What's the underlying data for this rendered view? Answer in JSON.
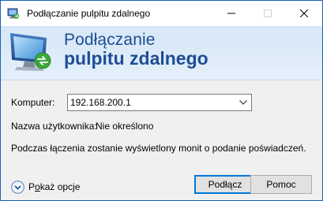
{
  "window": {
    "title": "Podłączanie pulpitu zdalnego"
  },
  "banner": {
    "line1": "Podłączanie",
    "line2": "pulpitu zdalnego"
  },
  "form": {
    "computer_label": "Komputer:",
    "computer_value": "192.168.200.1",
    "username_label": "Nazwa użytkownika:",
    "username_value": "Nie określono",
    "info_text": "Podczas łączenia zostanie wyświetlony monit o podanie poświadczeń."
  },
  "footer": {
    "options_prefix": "P",
    "options_accel": "o",
    "options_rest": "każ opcje",
    "connect_label": "Podłącz",
    "help_label": "Pomoc"
  },
  "icons": {
    "app": "remote-desktop-icon",
    "banner": "remote-desktop-monitor-icon",
    "combo_arrow": "chevron-down-icon",
    "options": "expand-circle-icon"
  },
  "colors": {
    "heading": "#1e4d94",
    "primary_border": "#0078d7",
    "window_border": "#1a62b8"
  }
}
